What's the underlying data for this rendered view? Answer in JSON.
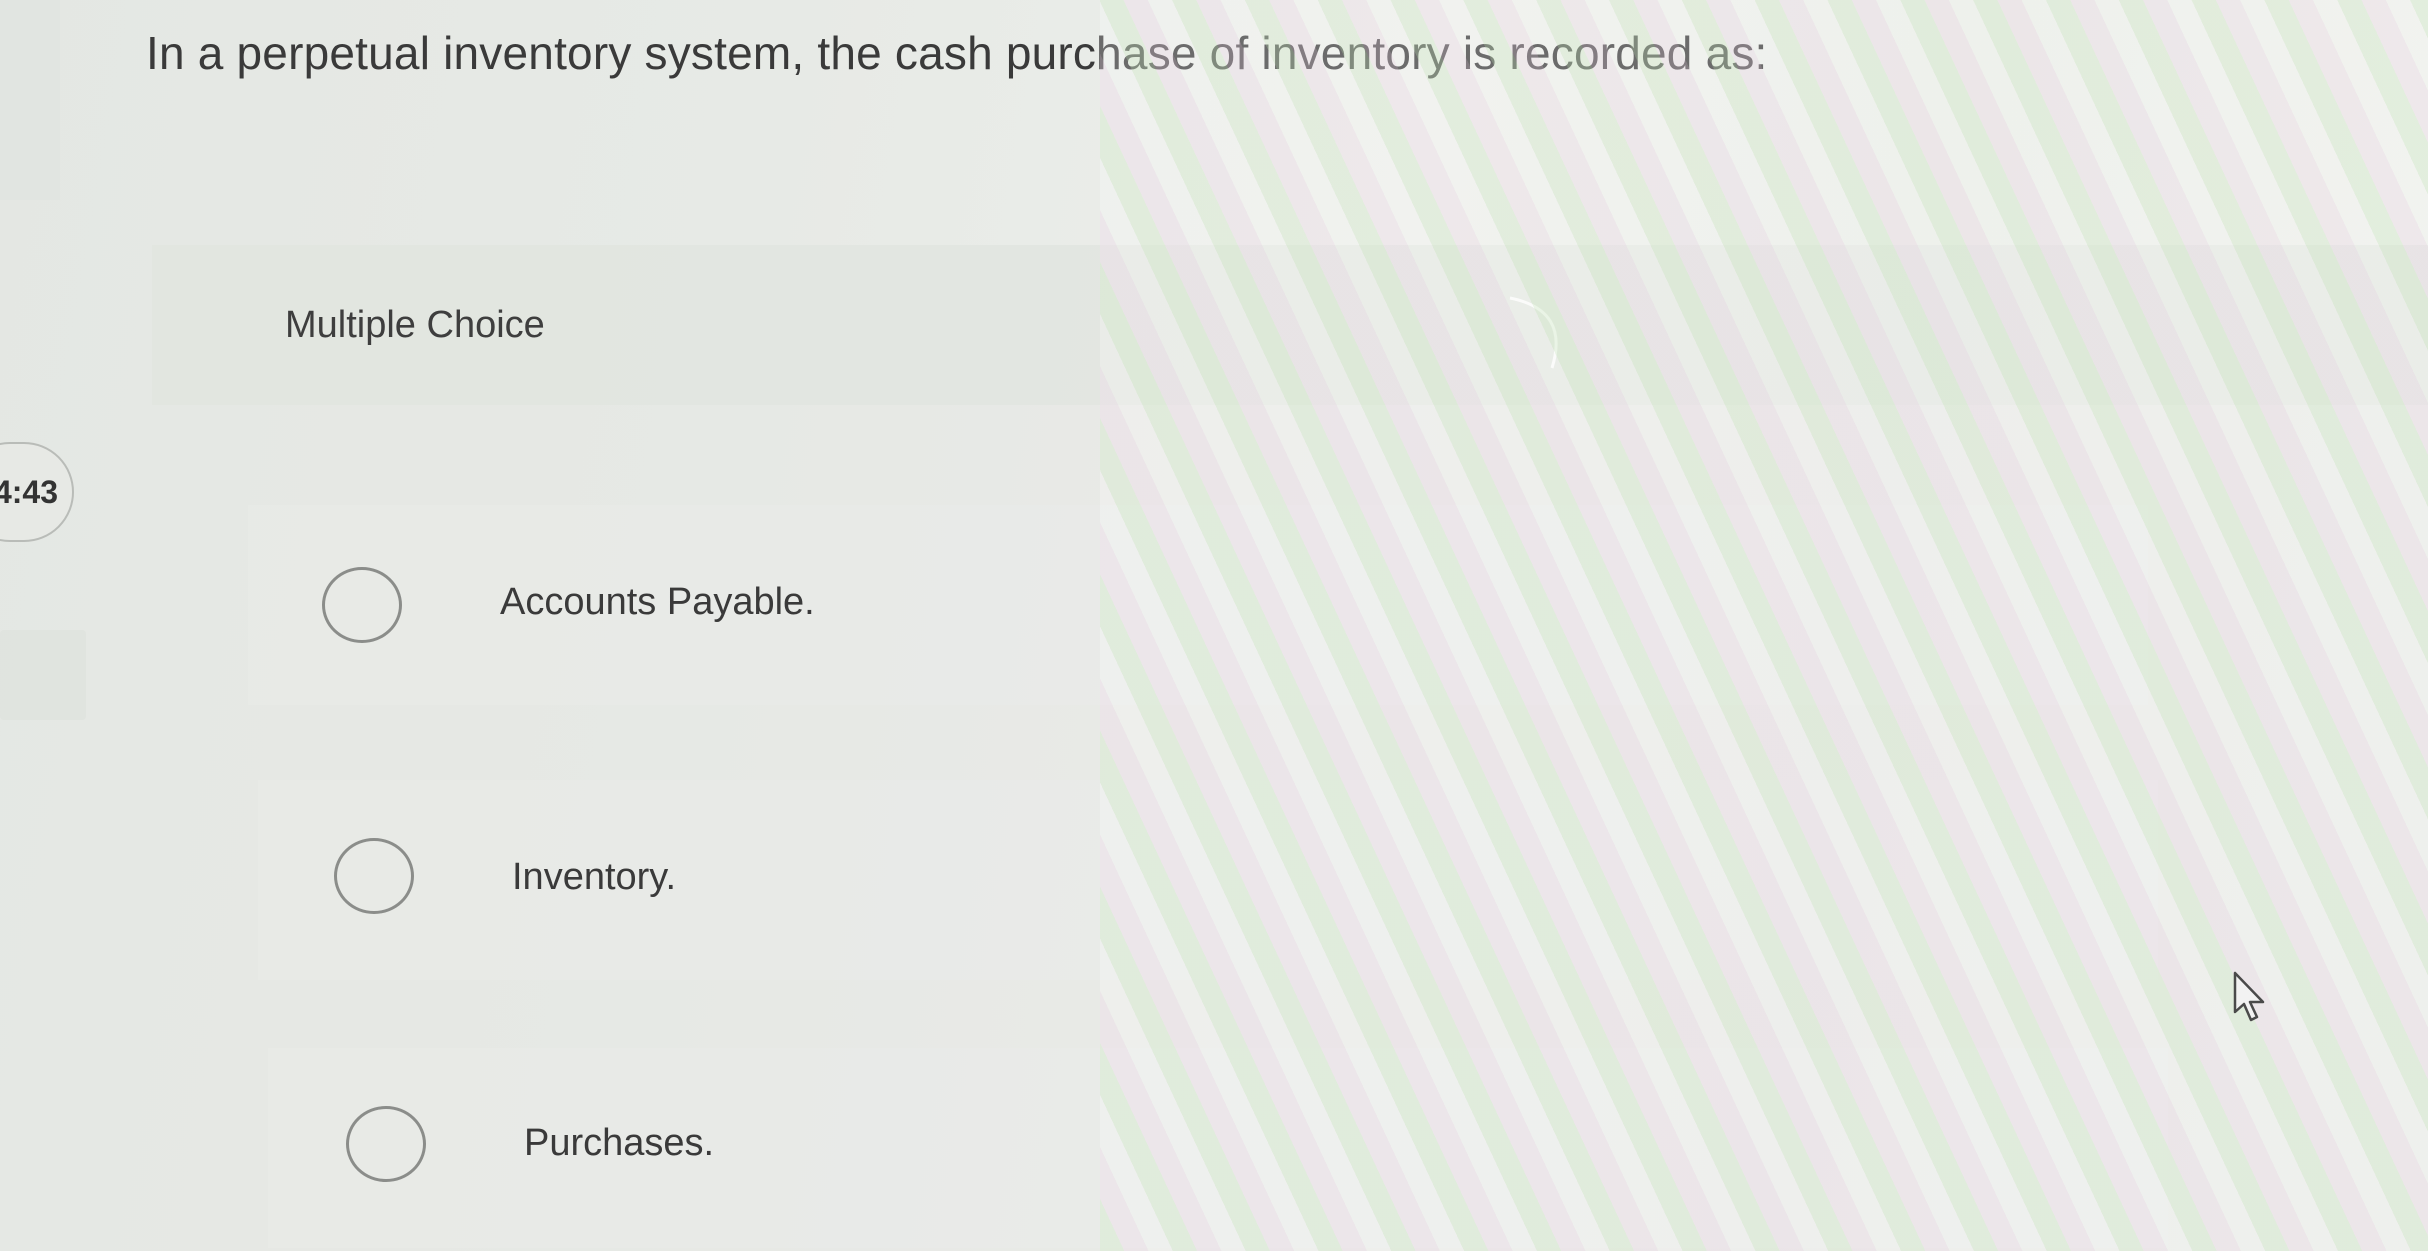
{
  "question": {
    "text": "In a perpetual inventory system, the cash purchase of inventory is recorded as:"
  },
  "timer": {
    "text": "4:43"
  },
  "section": {
    "label": "Multiple Choice"
  },
  "options": [
    {
      "label": "Accounts Payable.",
      "selected": false
    },
    {
      "label": "Inventory.",
      "selected": false
    },
    {
      "label": "Purchases.",
      "selected": false
    }
  ],
  "icons": {
    "cursor": "mouse-pointer-icon",
    "radio": "radio-circle-icon"
  },
  "colors": {
    "background": "#e6e9e5",
    "text": "#3a3a3a",
    "radio_border": "#8b8d8a"
  }
}
